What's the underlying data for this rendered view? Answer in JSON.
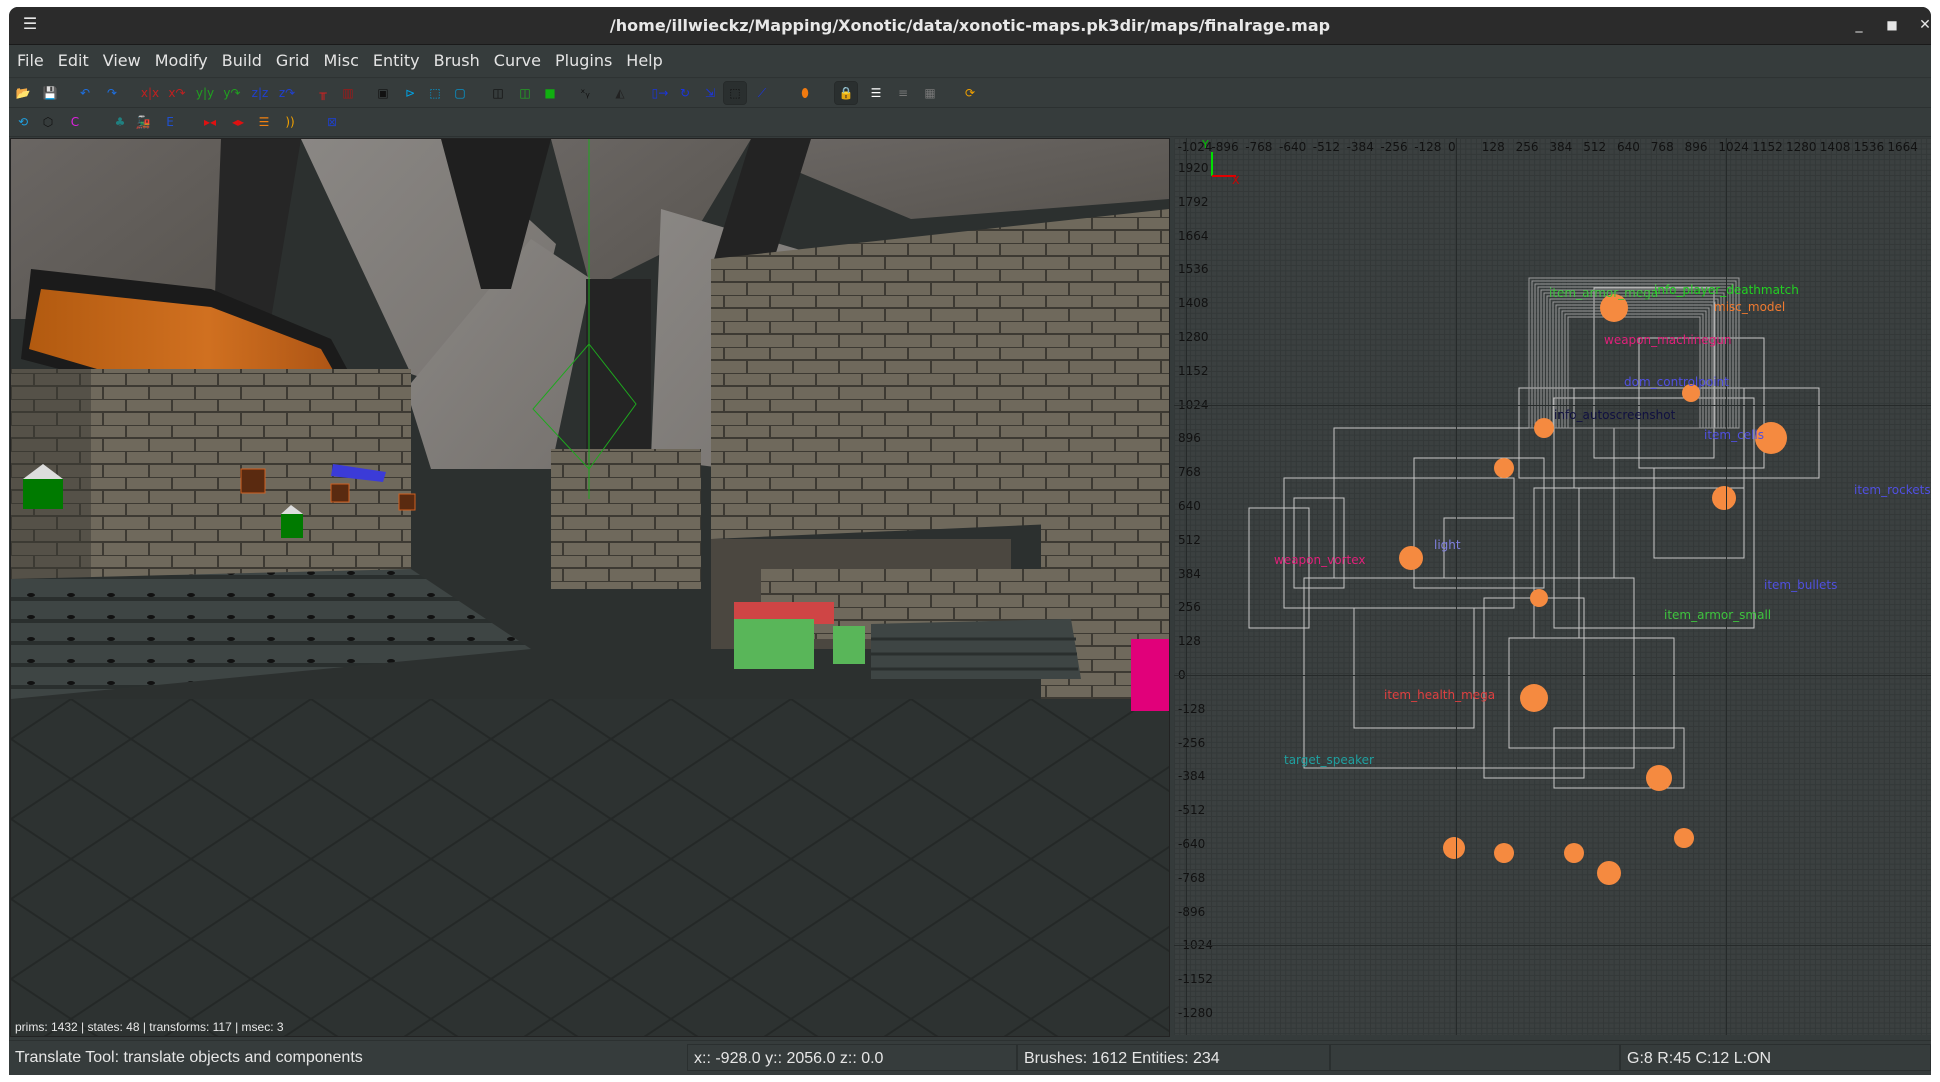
{
  "window": {
    "title": "/home/illwieckz/Mapping/Xonotic/data/xonotic-maps.pk3dir/maps/finalrage.map",
    "menu_icon": "hamburger-menu-icon",
    "controls": {
      "minimize": "_",
      "maximize": "□",
      "close": "✕"
    }
  },
  "menubar": {
    "items": [
      "File",
      "Edit",
      "View",
      "Modify",
      "Build",
      "Grid",
      "Misc",
      "Entity",
      "Brush",
      "Curve",
      "Plugins",
      "Help"
    ]
  },
  "toolbar1": {
    "buttons": [
      {
        "name": "open-icon",
        "glyph": "📂",
        "color": "#d8d000"
      },
      {
        "name": "save-icon",
        "glyph": "💾",
        "color": "#222222"
      },
      {
        "name": "undo-icon",
        "glyph": "↶",
        "color": "#1e6fe0"
      },
      {
        "name": "redo-icon",
        "glyph": "↷",
        "color": "#1e6fe0"
      },
      {
        "name": "flip-x-icon",
        "glyph": "x|x",
        "color": "#c02020"
      },
      {
        "name": "rotate-x-icon",
        "glyph": "x↷",
        "color": "#c02020"
      },
      {
        "name": "flip-y-icon",
        "glyph": "y|y",
        "color": "#20a020"
      },
      {
        "name": "rotate-y-icon",
        "glyph": "y↷",
        "color": "#20a020"
      },
      {
        "name": "flip-z-icon",
        "glyph": "z|z",
        "color": "#2040d0"
      },
      {
        "name": "rotate-z-icon",
        "glyph": "z↷",
        "color": "#2040d0"
      },
      {
        "name": "csg-subtract-icon",
        "glyph": "╥",
        "color": "#d02020"
      },
      {
        "name": "csg-merge-icon",
        "glyph": "▥",
        "color": "#a01818"
      },
      {
        "name": "select-inside-icon",
        "glyph": "▣",
        "color": "#111111"
      },
      {
        "name": "select-touching-icon",
        "glyph": "⊳",
        "color": "#00a0e0"
      },
      {
        "name": "select-partial-icon",
        "glyph": "⬚",
        "color": "#00a0e0"
      },
      {
        "name": "select-complete-icon",
        "glyph": "▢",
        "color": "#00a0e0"
      },
      {
        "name": "view-cubic-clip-icon",
        "glyph": "◫",
        "color": "#111111"
      },
      {
        "name": "view-texture-lock-icon",
        "glyph": "◫",
        "color": "#20b020"
      },
      {
        "name": "view-solid-icon",
        "glyph": "■",
        "color": "#10b010"
      },
      {
        "name": "view-change-icon",
        "glyph": "ˣᵧ",
        "color": "#111111"
      },
      {
        "name": "clipper-icon",
        "glyph": "◭",
        "color": "#222222"
      },
      {
        "name": "translate-icon",
        "glyph": "▯→",
        "color": "#1a35e0"
      },
      {
        "name": "rotate-icon",
        "glyph": "↻",
        "color": "#1a35e0"
      },
      {
        "name": "scale-icon",
        "glyph": "⇲",
        "color": "#1a35e0"
      },
      {
        "name": "resize-icon",
        "glyph": "⬚",
        "color": "#111111",
        "active": true
      },
      {
        "name": "skew-icon",
        "glyph": "⟋",
        "color": "#1a35e0"
      },
      {
        "name": "patch-icon",
        "glyph": "⬮",
        "color": "#f07a10"
      },
      {
        "name": "texture-lock-icon",
        "glyph": "🔒",
        "color": "#e0d000",
        "active": true
      },
      {
        "name": "entity-list-icon",
        "glyph": "☰",
        "color": "#ffffff"
      },
      {
        "name": "surface-inspector-icon",
        "glyph": "≡",
        "color": "#777777"
      },
      {
        "name": "texture-browser-icon",
        "glyph": "▦",
        "color": "#777777"
      },
      {
        "name": "refresh-models-icon",
        "glyph": "⟳",
        "color": "#f0a000"
      }
    ]
  },
  "toolbar2": {
    "buttons": [
      {
        "name": "reload-icon",
        "glyph": "⟲",
        "color": "#20a0e0"
      },
      {
        "name": "hexagon-icon",
        "glyph": "⬡",
        "color": "#111111"
      },
      {
        "name": "shader-icon",
        "glyph": "C",
        "color": "#e020e0"
      },
      {
        "name": "tree-icon",
        "glyph": "♣",
        "color": "#208080"
      },
      {
        "name": "train-icon",
        "glyph": "🚂",
        "color": "#111111"
      },
      {
        "name": "entity-e-icon",
        "glyph": "E",
        "color": "#2050d0"
      },
      {
        "name": "mirror-in-icon",
        "glyph": "▸◂",
        "color": "#e01010"
      },
      {
        "name": "mirror-out-icon",
        "glyph": "◂▸",
        "color": "#e01010"
      },
      {
        "name": "bevel-icon",
        "glyph": "☰",
        "color": "#f08010"
      },
      {
        "name": "endcap-icon",
        "glyph": "))",
        "color": "#f0a000"
      },
      {
        "name": "bounds-icon",
        "glyph": "⊠",
        "color": "#2040c0"
      }
    ]
  },
  "viewport3d": {
    "stats": "prims: 1432 | states: 48 | transforms: 117 | msec: 3"
  },
  "viewport2d": {
    "view": "XY",
    "x_ticks": [
      "-1024",
      "-896",
      "-768",
      "-640",
      "-512",
      "-384",
      "-256",
      "-128",
      "0",
      "128",
      "256",
      "384",
      "512",
      "640",
      "768",
      "896",
      "1024",
      "1152",
      "1280",
      "1408",
      "1536",
      "1664"
    ],
    "y_ticks": [
      "1920",
      "1792",
      "1664",
      "1536",
      "1408",
      "1280",
      "1152",
      "1024",
      "896",
      "768",
      "640",
      "512",
      "384",
      "256",
      "128",
      "0",
      "-128",
      "-256",
      "-384",
      "-512",
      "-640",
      "-768",
      "-896",
      "-1024",
      "-1152",
      "-1280"
    ],
    "axis_labels": {
      "x": "X",
      "y": "Y"
    },
    "entity_labels": [
      {
        "text": "item_armor_mega",
        "color": "#3ec43e"
      },
      {
        "text": "info_player_deathmatch",
        "color": "#22d022"
      },
      {
        "text": "misc_model",
        "color": "#f07a30"
      },
      {
        "text": "weapon_machinegun",
        "color": "#e0207a"
      },
      {
        "text": "dom_controlpoint",
        "color": "#5050e0"
      },
      {
        "text": "info_autoscreenshot",
        "color": "#101040"
      },
      {
        "text": "item_cells",
        "color": "#5050e0"
      },
      {
        "text": "item_rockets",
        "color": "#5050e0"
      },
      {
        "text": "item_bullets",
        "color": "#5050e0"
      },
      {
        "text": "item_armor_small",
        "color": "#3ec43e"
      },
      {
        "text": "item_health_mega",
        "color": "#e04040"
      },
      {
        "text": "weapon_vortex",
        "color": "#e0207a"
      },
      {
        "text": "light",
        "color": "#8080e0"
      },
      {
        "text": "target_speaker",
        "color": "#20a0a0"
      }
    ]
  },
  "statusbar": {
    "tool_hint": "Translate Tool: translate objects and components",
    "coords": "x:: -928.0  y:: 2056.0  z::    0.0",
    "counts": "Brushes: 1612 Entities: 234",
    "empty": "",
    "grid_info": "G:8  R:45  C:12  L:ON"
  }
}
